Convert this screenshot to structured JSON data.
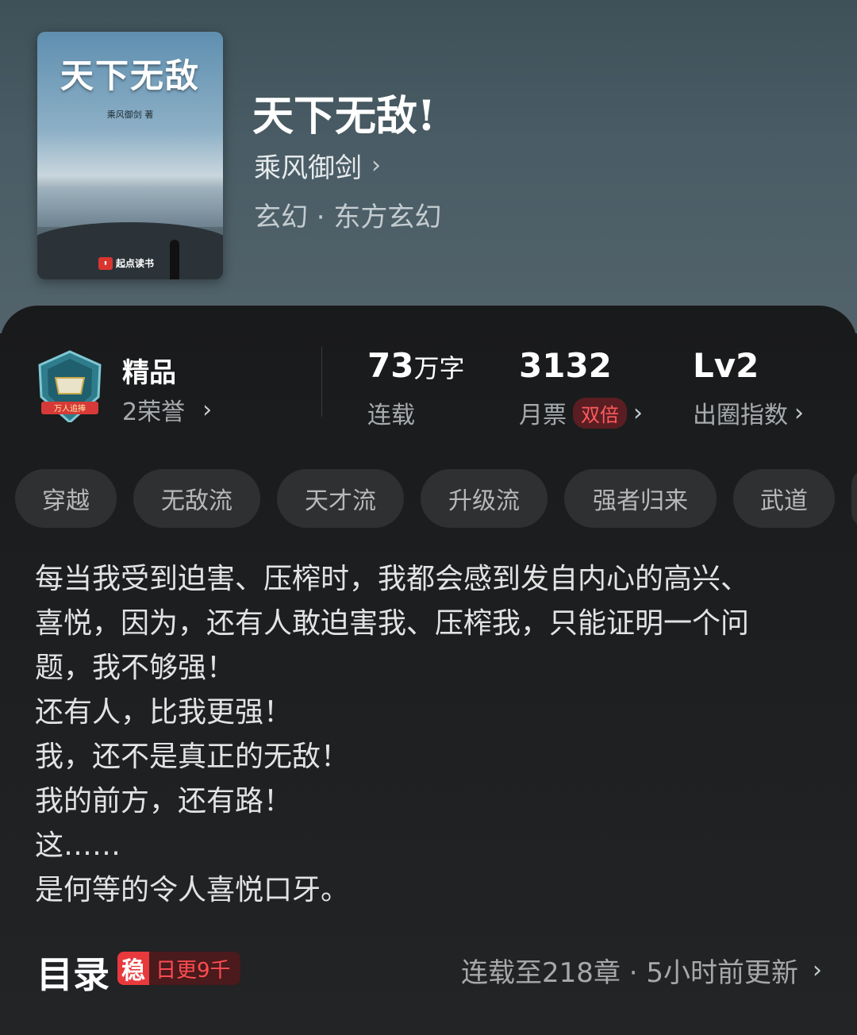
{
  "book": {
    "cover": {
      "title": "天下无敌",
      "author": "乘风御剑 著",
      "publisher": "起点读书"
    },
    "title": "天下无敌!",
    "author": "乘风御剑",
    "genre": "玄幻 · 东方玄幻"
  },
  "honors": {
    "badge_text": "万人追捧",
    "quality": "精品",
    "count": "2荣誉"
  },
  "stats": {
    "words_value": "73",
    "words_unit": "万字",
    "words_label": "连载",
    "tickets_value": "3132",
    "tickets_label": "月票",
    "tickets_tag": "双倍",
    "level_value": "Lv2",
    "level_label": "出圈指数"
  },
  "tags": [
    "穿越",
    "无敌流",
    "天才流",
    "升级流",
    "强者归来",
    "武道"
  ],
  "synopsis": [
    "每当我受到迫害、压榨时，我都会感到发自内心的高兴、",
    "喜悦，因为，还有人敢迫害我、压榨我，只能证明一个问",
    "题，我不够强！",
    "还有人，比我更强！",
    "我，还不是真正的无敌！",
    "我的前方，还有路！",
    "这……",
    "是何等的令人喜悦口牙。"
  ],
  "toc": {
    "title": "目录",
    "badge_mark": "稳",
    "badge_text": "日更9千",
    "status": "连载至218章 · 5小时前更新"
  },
  "icons": {
    "chevron": "chevron-right-icon",
    "badge": "honor-shield-icon"
  },
  "colors": {
    "accent_red": "#ff4d52",
    "panel_bg": "#1d1f21",
    "hero_bg": "#4a5c65"
  }
}
